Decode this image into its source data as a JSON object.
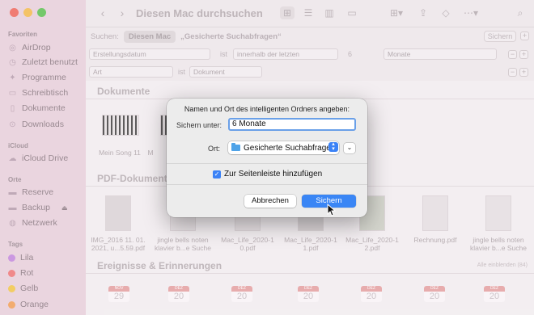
{
  "sidebar": {
    "sections": {
      "favorites": "Favoriten",
      "icloud": "iCloud",
      "places": "Orte",
      "tags": "Tags"
    },
    "favorites": [
      "AirDrop",
      "Zuletzt benutzt",
      "Programme",
      "Schreibtisch",
      "Dokumente",
      "Downloads"
    ],
    "icloud": [
      "iCloud Drive"
    ],
    "places": [
      "Reserve",
      "Backup",
      "Netzwerk"
    ],
    "tags": [
      {
        "label": "Lila",
        "color": "#c58be0"
      },
      {
        "label": "Rot",
        "color": "#f07a7a"
      },
      {
        "label": "Gelb",
        "color": "#f2c94c"
      },
      {
        "label": "Orange",
        "color": "#f2a35a"
      }
    ]
  },
  "toolbar": {
    "title": "Diesen Mac durchsuchen"
  },
  "search": {
    "label": "Suchen:",
    "scope_this_mac": "Diesen Mac",
    "scope_folder": "„Gesicherte Suchabfragen“",
    "save_button": "Sichern"
  },
  "criteria": [
    {
      "attribute": "Erstellungsdatum",
      "operator_label": "ist",
      "operator": "innerhalb der letzten",
      "value": "6",
      "unit": "Monate"
    },
    {
      "attribute": "Art",
      "operator_label": "ist",
      "operator": "Dokument"
    }
  ],
  "sections": {
    "documents": {
      "title": "Dokumente",
      "items": [
        "Mein Song 11",
        "M"
      ]
    },
    "pdf": {
      "title": "PDF-Dokumente",
      "items": [
        "IMG_2016 11. 01. 2021, u...5.59.pdf",
        "jingle bells noten klavier b...e Suche",
        "Mac_Life_2020-1 0.pdf",
        "Mac_Life_2020-1 1.pdf",
        "Mac_Life_2020-1 2.pdf",
        "Rechnung.pdf",
        "jingle bells noten klavier b...e Suche"
      ]
    },
    "events": {
      "title": "Ereignisse & Erinnerungen",
      "show_all": "Alle einblenden (84)",
      "calendars": [
        {
          "month": "NOV",
          "day": "29"
        },
        {
          "month": "DEZ",
          "day": "20"
        },
        {
          "month": "DEZ",
          "day": "20"
        },
        {
          "month": "DEZ",
          "day": "20"
        },
        {
          "month": "DEZ",
          "day": "20"
        },
        {
          "month": "DEZ",
          "day": "20"
        },
        {
          "month": "DEZ",
          "day": "20"
        }
      ]
    }
  },
  "dialog": {
    "title": "Namen und Ort des intelligenten Ordners angeben:",
    "save_as_label": "Sichern unter:",
    "save_as_value": "6 Monate",
    "location_label": "Ort:",
    "location_value": "Gesicherte Suchabfragen",
    "sidebar_checkbox_label": "Zur Seitenleiste hinzufügen",
    "sidebar_checkbox_checked": true,
    "cancel_button": "Abbrechen",
    "save_button": "Sichern"
  },
  "colors": {
    "accent": "#3a86f5",
    "sidebar_bg": "#e9d3dd"
  }
}
